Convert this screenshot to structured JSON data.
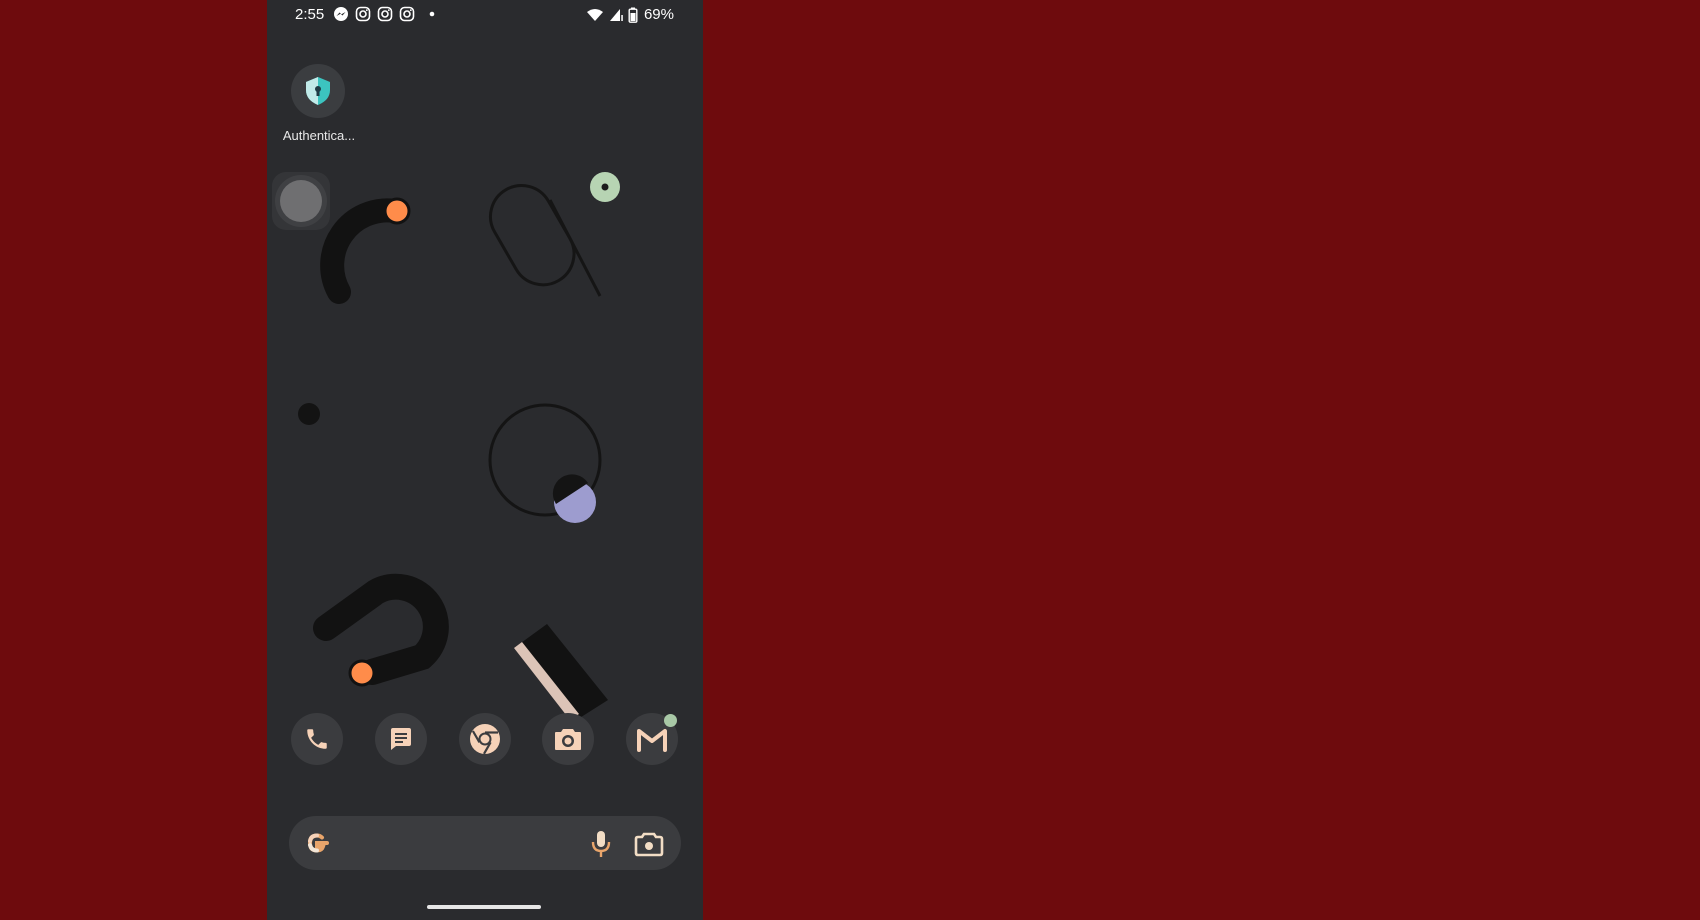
{
  "status_bar": {
    "time": "2:55",
    "notifications": [
      "messenger-icon",
      "instagram-icon",
      "instagram-icon",
      "instagram-icon",
      "more-dot-icon"
    ],
    "battery_percent": "69%"
  },
  "home": {
    "apps": [
      {
        "label": "Authentica...",
        "icon": "shield-lock-icon",
        "accent": "#3cc4c0"
      }
    ]
  },
  "dock": {
    "apps": [
      {
        "name": "Phone",
        "icon": "phone-icon"
      },
      {
        "name": "Messages",
        "icon": "messages-icon"
      },
      {
        "name": "Chrome",
        "icon": "chrome-icon"
      },
      {
        "name": "Camera",
        "icon": "camera-icon"
      },
      {
        "name": "Gmail",
        "icon": "gmail-icon",
        "badge": true
      }
    ],
    "icon_color": "#f6d2b8"
  },
  "search": {
    "icons": [
      "google-g-icon",
      "mic-icon",
      "lens-icon"
    ]
  },
  "colors": {
    "outer_background": "#6e0b0d",
    "screen_background": "#2a2b2e",
    "accent_orange": "#ff8c4a",
    "accent_green": "#b7d4b3",
    "accent_lavender": "#9d9ccf"
  }
}
